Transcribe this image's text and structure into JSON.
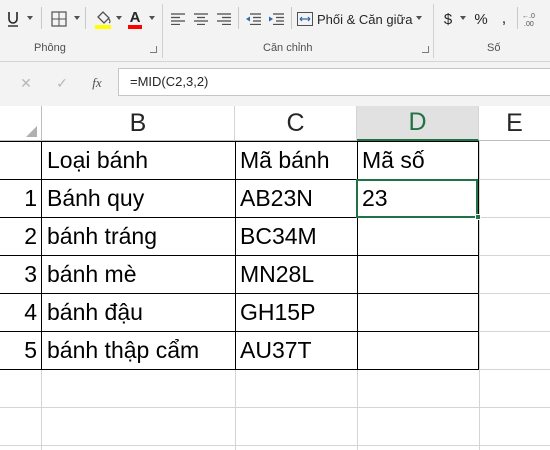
{
  "ribbon": {
    "font_group_label": "Phông",
    "alignment_group_label": "Căn chỉnh",
    "number_group_label": "Số",
    "merge_center_label": "Phối & Căn giữa",
    "currency_symbol": "$",
    "percent_symbol": "%",
    "comma_symbol": ",",
    "accent_color": "#217346",
    "highlight_color": "#ffff00",
    "font_color": "#ff0000"
  },
  "formula_bar": {
    "cancel_symbol": "✕",
    "enter_symbol": "✓",
    "function_symbol": "fx",
    "formula": "=MID(C2,3,2)"
  },
  "grid": {
    "columns": [
      "B",
      "C",
      "D",
      "E"
    ],
    "selected_column": "D",
    "rows": [
      {
        "number": "",
        "b": "Loại bánh",
        "c": "Mã bánh",
        "d": "Mã số"
      },
      {
        "number": "1",
        "b": "Bánh quy",
        "c": "AB23N",
        "d": "23"
      },
      {
        "number": "2",
        "b": "bánh tráng",
        "c": "BC34M",
        "d": ""
      },
      {
        "number": "3",
        "b": "bánh mè",
        "c": "MN28L",
        "d": ""
      },
      {
        "number": "4",
        "b": "bánh đậu",
        "c": "GH15P",
        "d": ""
      },
      {
        "number": "5",
        "b": "bánh thập cẩm",
        "c": "AU37T",
        "d": ""
      }
    ]
  }
}
